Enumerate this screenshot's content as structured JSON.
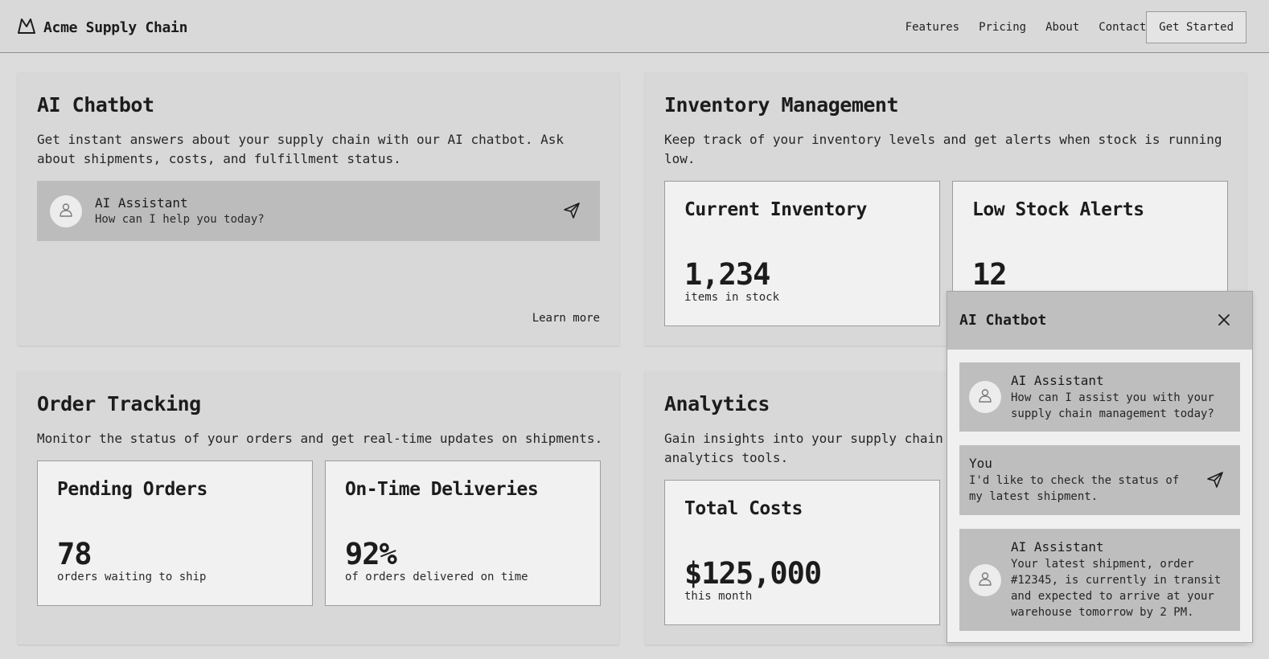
{
  "header": {
    "brand": "Acme Supply Chain",
    "logo_icon": "mountain-icon",
    "nav": [
      "Features",
      "Pricing",
      "About",
      "Contact"
    ],
    "cta": "Get Started"
  },
  "chatbot_card": {
    "title": "AI Chatbot",
    "description_line1": "Get instant answers about your supply chain with our AI chatbot. Ask",
    "description_line2": "about shipments, costs, and fulfillment status.",
    "assistant_name": "AI Assistant",
    "assistant_message": "How can I help you today?",
    "learn_more": "Learn more"
  },
  "inventory_card": {
    "title": "Inventory Management",
    "description_line1": "Keep track of your inventory levels and get alerts when stock is running",
    "description_line2": "low.",
    "stats": [
      {
        "title": "Current Inventory",
        "value": "1,234",
        "caption": "items in stock"
      },
      {
        "title": "Low Stock Alerts",
        "value": "12",
        "caption": ""
      }
    ]
  },
  "orders_card": {
    "title": "Order Tracking",
    "description_line1": "Monitor the status of your orders and get real-time updates on shipments.",
    "stats": [
      {
        "title": "Pending Orders",
        "value": "78",
        "caption": "orders waiting to ship"
      },
      {
        "title": "On-Time Deliveries",
        "value": "92%",
        "caption": "of orders delivered on time"
      }
    ]
  },
  "analytics_card": {
    "title": "Analytics",
    "description_line1": "Gain insights into your supply chain",
    "description_line2": "analytics tools.",
    "stats": [
      {
        "title": "Total Costs",
        "value": "$125,000",
        "caption": "this month"
      }
    ]
  },
  "chat_popup": {
    "title": "AI Chatbot",
    "messages": [
      {
        "sender": "AI Assistant",
        "lines": [
          "How can I assist you with your",
          "supply chain management today?"
        ]
      },
      {
        "sender": "You",
        "lines": [
          "I'd like to check the status of",
          "my latest shipment."
        ]
      },
      {
        "sender": "AI Assistant",
        "lines": [
          "Your latest shipment, order",
          "#12345, is currently in transit",
          "and expected to arrive at your",
          "warehouse tomorrow by 2 PM."
        ]
      }
    ]
  }
}
